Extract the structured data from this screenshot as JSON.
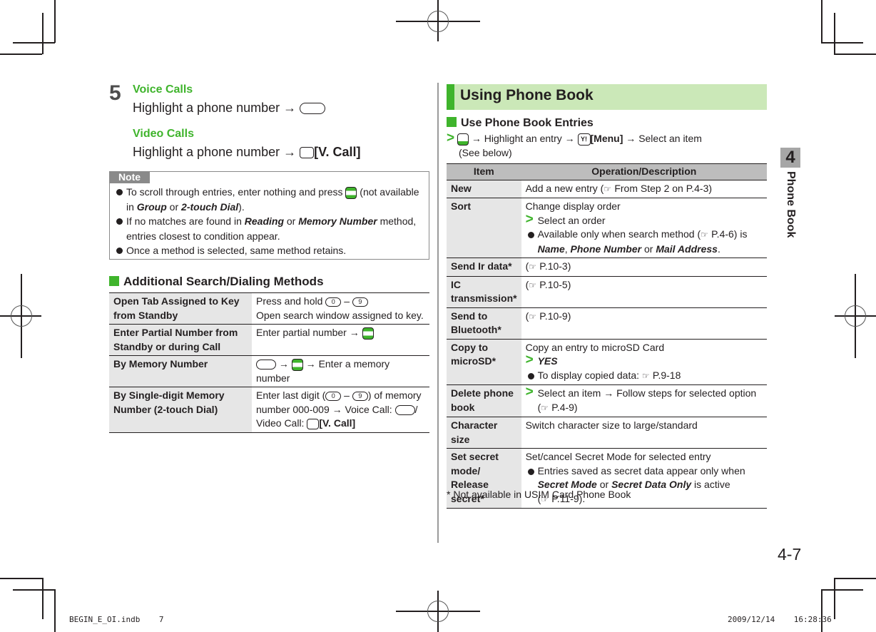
{
  "step": {
    "number": "5",
    "voice_heading": "Voice Calls",
    "voice_text": "Highlight a phone number",
    "video_heading": "Video Calls",
    "video_text": "Highlight a phone number",
    "video_softkey": "[V. Call]",
    "arrow": "→"
  },
  "note": {
    "label": "Note",
    "items": [
      {
        "pre": "To scroll through entries, enter nothing and press",
        "post": "(not available in",
        "b1": "Group",
        "mid": " or ",
        "b2": "2-touch Dial",
        "end": ")."
      },
      {
        "pre": "If no matches are found in ",
        "b1": "Reading",
        "mid": " or ",
        "b2": "Memory Number",
        "post": " method, entries closest to condition appear."
      },
      {
        "text": "Once a method is selected, same method retains."
      }
    ]
  },
  "additional": {
    "heading": "Additional Search/Dialing Methods",
    "rows": [
      {
        "label": "Open Tab Assigned to Key from Standby",
        "line1_pre": "Press and hold",
        "dash": "–",
        "line2": "Open search window assigned to key.",
        "key0": "0",
        "key9": "9"
      },
      {
        "label": "Enter Partial Number from Standby or during Call",
        "text": "Enter partial number"
      },
      {
        "label": "By Memory Number",
        "text": "Enter a memory number"
      },
      {
        "label": "By Single-digit Memory Number (2-touch Dial)",
        "t1": "Enter last digit (",
        "t2": ") of memory number 000-009",
        "t3": "Voice Call:",
        "t4": "/",
        "t5": "Video Call:",
        "t6": "[V. Call]"
      }
    ]
  },
  "right": {
    "title": "Using Phone Book",
    "section": "Use Phone Book Entries",
    "instr": {
      "a": "Highlight an entry",
      "b": "[Menu]",
      "c": "Select an item",
      "d": "(See below)",
      "ykey": "Y!"
    },
    "table": {
      "headers": [
        "Item",
        "Operation/Description"
      ],
      "rows": [
        {
          "item": "New",
          "desc": "Add a new entry (",
          "ref": "From Step 2 on P.4-3)"
        },
        {
          "item": "Sort",
          "l1": "Change display order",
          "l2": "Select an order",
          "l3": "Available only when search method (",
          "l3ref": "P.4-6) is",
          "b1": "Name",
          "b2": "Phone Number",
          "or": " or ",
          "b3": "Mail Address"
        },
        {
          "item": "Send Ir data*",
          "ref": "P.10-3)"
        },
        {
          "item": "IC transmission*",
          "ref": "P.10-5)"
        },
        {
          "item": "Send to Bluetooth*",
          "ref": "P.10-9)"
        },
        {
          "item": "Copy to microSD*",
          "l1": "Copy an entry to microSD Card",
          "l2": "YES",
          "l3": "To display copied data: ",
          "l3ref": "P.9-18"
        },
        {
          "item": "Delete phone book",
          "l1": "Select an item",
          "l1b": "Follow steps for selected option",
          "ref": "P.4-9)"
        },
        {
          "item": "Character size",
          "l1": "Switch character size to large/standard"
        },
        {
          "item": "Set secret mode/ Release secret*",
          "l1": "Set/cancel Secret Mode for selected entry",
          "l2": "Entries saved as secret data appear only when",
          "b1": "Secret Mode",
          "or": " or ",
          "b2": "Secret Data Only",
          "l3": " is active",
          "ref": "P.11-9)."
        }
      ]
    },
    "footnote": "* Not available in USIM Card Phone Book"
  },
  "chapter": {
    "number": "4",
    "label": "Phone Book"
  },
  "page_number": "4-7",
  "slug": {
    "file": "BEGIN_E_OI.indb    7",
    "datetime": "2009/12/14    16:28:36"
  },
  "colors": {
    "accent_green": "#3fb42c",
    "title_bg": "#cbe8b8",
    "header_gray": "#bdbdbd",
    "label_gray": "#e6e6e6"
  }
}
